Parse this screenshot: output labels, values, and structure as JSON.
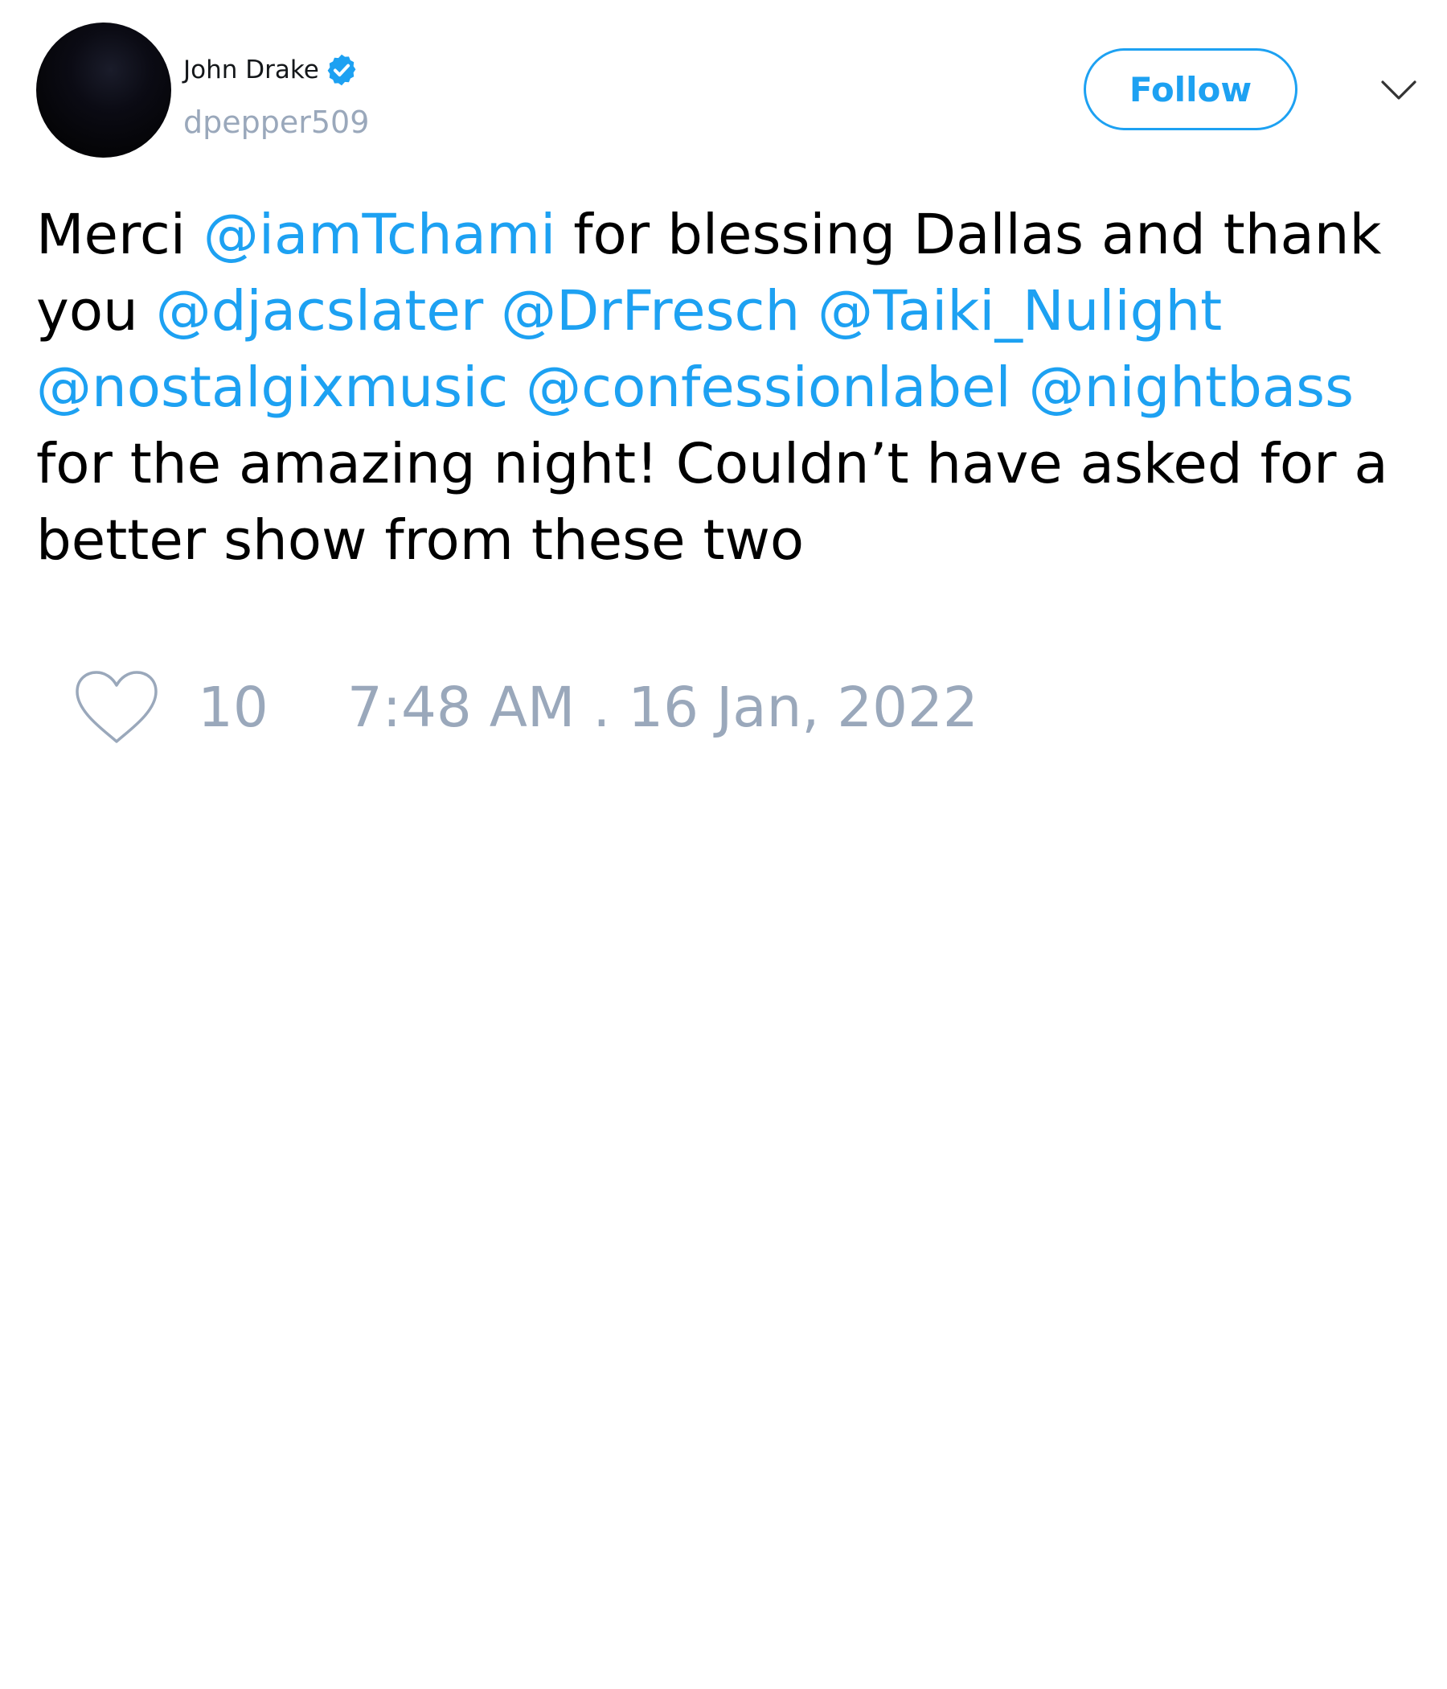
{
  "author": {
    "display_name": "John Drake",
    "handle": "dpepper509",
    "verified": true,
    "avatar_icon": "profile-photo-dark"
  },
  "actions": {
    "follow_label": "Follow",
    "menu_icon": "chevron-down-icon"
  },
  "tweet": {
    "segments": [
      {
        "type": "text",
        "text": "Merci "
      },
      {
        "type": "mention",
        "text": "@iamTchami"
      },
      {
        "type": "text",
        "text": " for blessing Dallas and thank you "
      },
      {
        "type": "mention",
        "text": "@djacslater"
      },
      {
        "type": "text",
        "text": " "
      },
      {
        "type": "mention",
        "text": "@DrFresch"
      },
      {
        "type": "text",
        "text": " "
      },
      {
        "type": "mention",
        "text": "@Taiki_Nulight"
      },
      {
        "type": "text",
        "text": " "
      },
      {
        "type": "mention",
        "text": "@nostalgixmusic"
      },
      {
        "type": "text",
        "text": " "
      },
      {
        "type": "mention",
        "text": "@confessionlabel"
      },
      {
        "type": "text",
        "text": " "
      },
      {
        "type": "mention",
        "text": "@nightbass"
      },
      {
        "type": "text",
        "text": " for the amazing night! Couldn’t have asked for a better show from these two"
      }
    ]
  },
  "footer": {
    "like_icon": "heart-outline-icon",
    "like_count": "10",
    "timestamp": "7:48 AM . 16 Jan, 2022"
  },
  "colors": {
    "accent": "#1da1f2",
    "muted": "#9aa8bb",
    "text": "#000000",
    "background": "#ffffff"
  }
}
